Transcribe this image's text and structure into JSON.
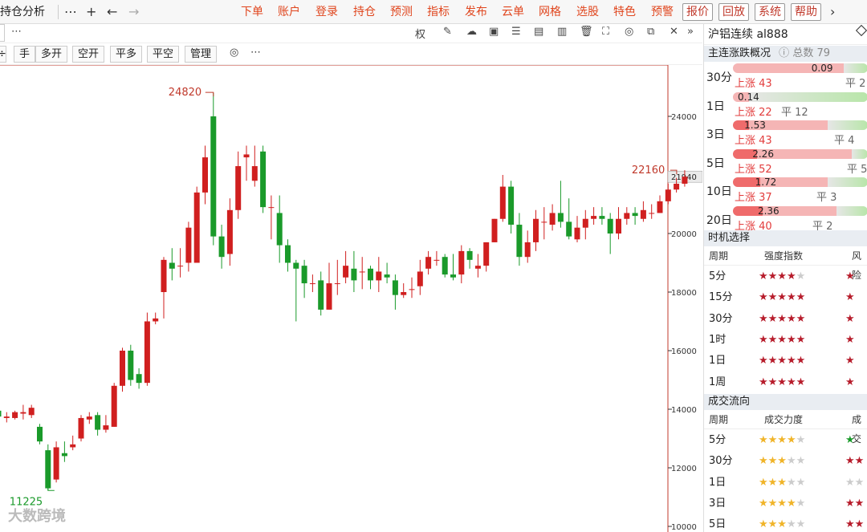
{
  "topbar": {
    "tab_title": "持仓分析",
    "more_icon": "⋯",
    "add_icon": "+",
    "back_icon": "←",
    "forward_icon": "→",
    "menu": [
      "下单",
      "账户",
      "登录",
      "持仓",
      "预测",
      "指标",
      "发布",
      "云单",
      "网格",
      "选股",
      "特色",
      "预警"
    ],
    "boxed_menu": [
      "报价",
      "回放",
      "系统",
      "帮助"
    ],
    "chevron_icon": "›"
  },
  "toolbar": {
    "more_icon": "⋯",
    "right_labels": {
      "quan": "权"
    },
    "buttons": [
      "手",
      "多开",
      "空开",
      "平多",
      "平空",
      "管理"
    ],
    "settings_icon": "◎",
    "more2": "⋯"
  },
  "chart_data": {
    "type": "candlestick",
    "ylim": [
      10000,
      25500
    ],
    "ticks": [
      24000,
      22000,
      20000,
      18000,
      16000,
      14000,
      12000,
      10000
    ],
    "tick_labels": [
      "24000",
      "22000",
      "20000",
      "18000",
      "16000",
      "14000",
      "12000",
      "10000"
    ],
    "last_price_label": "21940",
    "annotations": [
      {
        "text": "24820",
        "color": "#c0392b"
      },
      {
        "text": "22160",
        "color": "#c0392b"
      },
      {
        "text": "11225",
        "color": "#1a9a2a"
      }
    ],
    "candles": [
      [
        13950,
        13750,
        14000,
        13600
      ],
      [
        13700,
        13750,
        13900,
        13550
      ],
      [
        13700,
        13900,
        13950,
        13650
      ],
      [
        13850,
        13900,
        14150,
        13650
      ],
      [
        13800,
        14050,
        14150,
        13700
      ],
      [
        13400,
        12900,
        13500,
        12800
      ],
      [
        12600,
        11300,
        12800,
        11225
      ],
      [
        11600,
        12700,
        12900,
        11500
      ],
      [
        12500,
        12400,
        12900,
        12200
      ],
      [
        12700,
        12800,
        13100,
        12600
      ],
      [
        13000,
        13700,
        13800,
        12900
      ],
      [
        13650,
        13750,
        13900,
        13500
      ],
      [
        13800,
        13300,
        13900,
        13100
      ],
      [
        13300,
        13450,
        13800,
        13200
      ],
      [
        13400,
        14800,
        14900,
        13400
      ],
      [
        14800,
        16000,
        16100,
        14600
      ],
      [
        16000,
        15000,
        16200,
        14800
      ],
      [
        15200,
        14900,
        15400,
        14700
      ],
      [
        14900,
        17000,
        17300,
        14800
      ],
      [
        17000,
        17100,
        17300,
        16900
      ],
      [
        18000,
        19100,
        19200,
        17100
      ],
      [
        19000,
        18800,
        19500,
        18400
      ],
      [
        18900,
        18900,
        19500,
        18500
      ],
      [
        19000,
        20200,
        20400,
        18700
      ],
      [
        19000,
        21400,
        21600,
        19000
      ],
      [
        21400,
        22600,
        23000,
        21000
      ],
      [
        24000,
        19900,
        24800,
        19600
      ],
      [
        19900,
        19200,
        20300,
        18800
      ],
      [
        19300,
        20800,
        21200,
        18900
      ],
      [
        20800,
        22300,
        22800,
        20500
      ],
      [
        22600,
        22700,
        23000,
        21800
      ],
      [
        21800,
        22300,
        23000,
        21600
      ],
      [
        22800,
        20900,
        23000,
        20700
      ],
      [
        20900,
        20900,
        21300,
        19800
      ],
      [
        20700,
        19600,
        21300,
        19000
      ],
      [
        19600,
        19000,
        19800,
        18700
      ],
      [
        19000,
        18800,
        19100,
        17000
      ],
      [
        18900,
        18300,
        19100,
        17800
      ],
      [
        18300,
        18300,
        18600,
        18000
      ],
      [
        18400,
        17400,
        18700,
        17200
      ],
      [
        17400,
        18300,
        19000,
        17400
      ],
      [
        18300,
        18300,
        19100,
        17900
      ],
      [
        18500,
        18900,
        19400,
        18300
      ],
      [
        18800,
        18400,
        19400,
        18000
      ],
      [
        18700,
        18700,
        19200,
        18100
      ],
      [
        18800,
        18400,
        18900,
        18100
      ],
      [
        18400,
        18700,
        19200,
        18000
      ],
      [
        18600,
        18500,
        19000,
        18300
      ],
      [
        18400,
        17900,
        18600,
        17400
      ],
      [
        17900,
        18000,
        18300,
        17800
      ],
      [
        18100,
        18100,
        18500,
        17800
      ],
      [
        18200,
        18700,
        19100,
        17900
      ],
      [
        18800,
        19200,
        19400,
        18600
      ],
      [
        19100,
        19100,
        19400,
        18900
      ],
      [
        19200,
        18600,
        19300,
        18500
      ],
      [
        18600,
        18500,
        19300,
        18400
      ],
      [
        18600,
        19400,
        19600,
        18300
      ],
      [
        19400,
        19100,
        19500,
        18800
      ],
      [
        18800,
        18900,
        19300,
        18500
      ],
      [
        18900,
        19700,
        19700,
        18700
      ],
      [
        19700,
        20500,
        20500,
        19700
      ],
      [
        20500,
        21600,
        22000,
        20400
      ],
      [
        21600,
        20300,
        21800,
        20000
      ],
      [
        20300,
        19200,
        20700,
        18900
      ],
      [
        19200,
        19700,
        20100,
        19000
      ],
      [
        19700,
        20500,
        20800,
        19400
      ],
      [
        20400,
        20400,
        20900,
        19800
      ],
      [
        20300,
        20700,
        21000,
        20100
      ],
      [
        20700,
        20400,
        21800,
        20200
      ],
      [
        20400,
        19900,
        21200,
        19800
      ],
      [
        19800,
        20200,
        20600,
        19700
      ],
      [
        20200,
        20500,
        20800,
        19800
      ],
      [
        20500,
        20600,
        20900,
        20300
      ],
      [
        20600,
        20500,
        20900,
        20300
      ],
      [
        20500,
        20000,
        20700,
        19300
      ],
      [
        20000,
        20500,
        20900,
        19800
      ],
      [
        20500,
        20700,
        20900,
        20300
      ],
      [
        20700,
        20600,
        20900,
        20300
      ],
      [
        20500,
        20800,
        21100,
        20400
      ],
      [
        20700,
        20700,
        21000,
        20500
      ],
      [
        20700,
        21100,
        21300,
        20700
      ],
      [
        21100,
        21500,
        21700,
        21000
      ],
      [
        21500,
        21700,
        21900,
        21400
      ],
      [
        21700,
        21940,
        22160,
        21600
      ]
    ]
  },
  "watermark": "大数跨境",
  "right_panel": {
    "title": "沪铝连续  al888",
    "section1": {
      "title": "主连涨跌概况",
      "help_icon": "?",
      "subtitle": "总数 79"
    },
    "periods": [
      {
        "label": "30分",
        "value": "0.09",
        "up": "上涨 43",
        "flat": "平 2",
        "red": 0.0,
        "pink": 0.82
      },
      {
        "label": "1日",
        "value": "0.14",
        "up": "上涨 22",
        "flat": "平 12",
        "red": 0.0,
        "pink": 0.12
      },
      {
        "label": "3日",
        "value": "1.53",
        "up": "上涨 43",
        "flat": "平 4",
        "red": 0.12,
        "pink": 0.58
      },
      {
        "label": "5日",
        "value": "2.26",
        "up": "上涨 52",
        "flat": "平 5",
        "red": 0.18,
        "pink": 0.7
      },
      {
        "label": "10日",
        "value": "1.72",
        "up": "上涨 37",
        "flat": "平 3",
        "red": 0.2,
        "pink": 0.5
      },
      {
        "label": "20日",
        "value": "2.36",
        "up": "上涨 40",
        "flat": "平 2",
        "red": 0.22,
        "pink": 0.55
      }
    ],
    "section2": {
      "title": "时机选择",
      "col1": "周期",
      "col2": "强度指数",
      "col3": "风险"
    },
    "timing": [
      {
        "p": "5分",
        "s": "★★★★",
        "e": "★",
        "r": "★"
      },
      {
        "p": "15分",
        "s": "★★★★★",
        "e": "",
        "r": "★"
      },
      {
        "p": "30分",
        "s": "★★★★★",
        "e": "",
        "r": "★"
      },
      {
        "p": "1时",
        "s": "★★★★★",
        "e": "",
        "r": "★"
      },
      {
        "p": "1日",
        "s": "★★★★★",
        "e": "",
        "r": "★"
      },
      {
        "p": "1周",
        "s": "★★★★★",
        "e": "",
        "r": "★"
      }
    ],
    "section3": {
      "title": "成交流向",
      "col1": "周期",
      "col2": "成交力度",
      "col3": "成交"
    },
    "flow": [
      {
        "p": "5分",
        "s": "★★★★",
        "e": "★",
        "r": "★",
        "rcolor": "#1a9a2a"
      },
      {
        "p": "30分",
        "s": "★★★",
        "e": "★★",
        "r": "★★",
        "rcolor": "#b71c2b"
      },
      {
        "p": "1日",
        "s": "★★★",
        "e": "★★",
        "r": "★★",
        "rcolor": "#ccc"
      },
      {
        "p": "3日",
        "s": "★★★★",
        "e": "★",
        "r": "★★",
        "rcolor": "#b71c2b"
      },
      {
        "p": "5日",
        "s": "★★★",
        "e": "★★",
        "r": "★★",
        "rcolor": "#b71c2b"
      }
    ]
  }
}
